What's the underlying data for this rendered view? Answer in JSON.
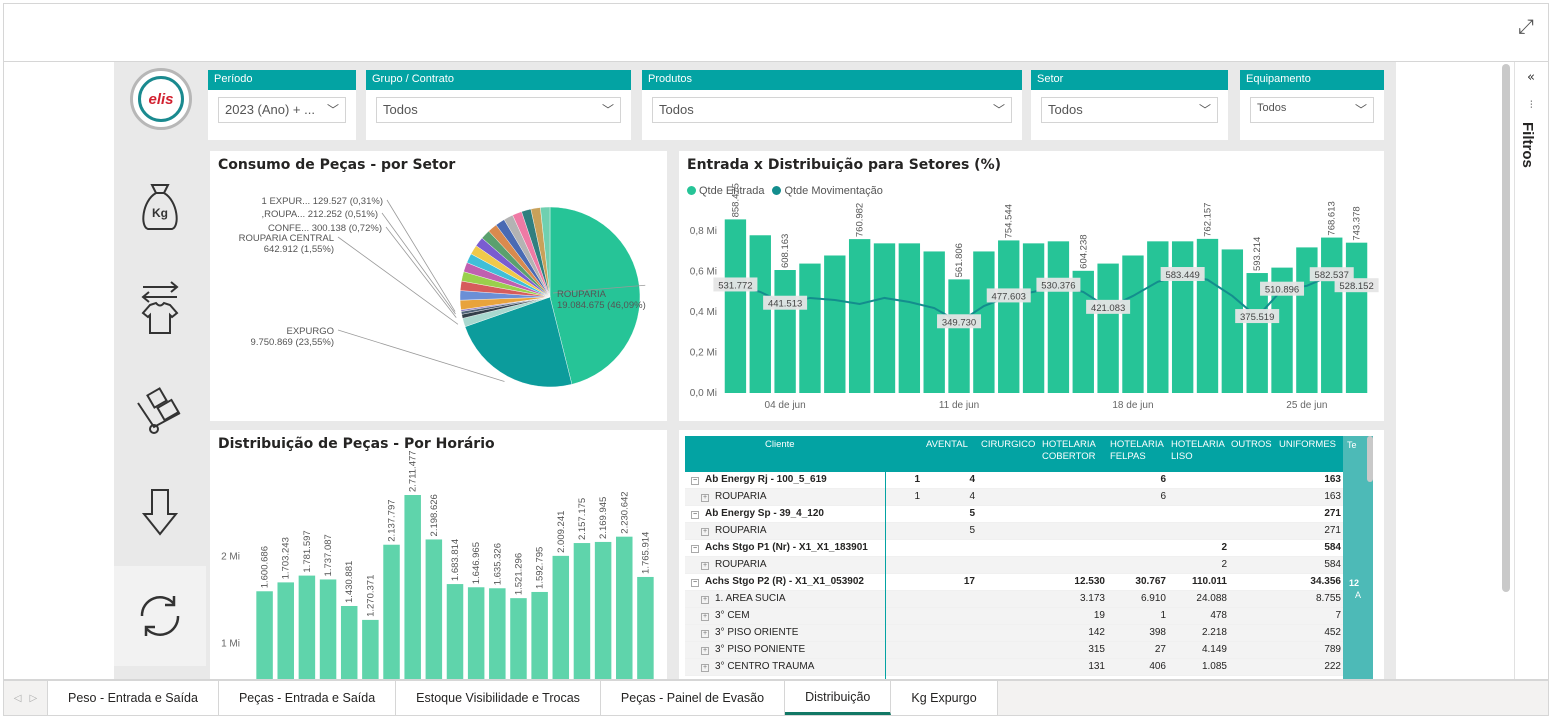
{
  "slicers": [
    {
      "label": "Período",
      "value": "2023 (Ano) + ..."
    },
    {
      "label": "Grupo / Contrato",
      "value": "Todos"
    },
    {
      "label": "Produtos",
      "value": "Todos"
    },
    {
      "label": "Setor",
      "value": "Todos"
    },
    {
      "label": "Equipamento",
      "value": "Todos"
    }
  ],
  "logo": {
    "text": "elis"
  },
  "nav_icons": [
    "kg-bag-icon",
    "shirt-exchange-icon",
    "hand-truck-boxes-icon",
    "arrow-down-icon",
    "refresh-icon"
  ],
  "filters_pane": {
    "label": "Filtros"
  },
  "tabs": [
    "Peso - Entrada e Saída",
    "Peças - Entrada e Saída",
    "Estoque Visibilidade e Trocas",
    "Peças - Painel de Evasão",
    "Distribuição",
    "Kg Expurgo"
  ],
  "active_tab": "Distribuição",
  "colors": {
    "accent": "#03a3a3",
    "bar": "#26c497",
    "line": "#138d8d",
    "pie_teal": "#0c9c9c"
  },
  "chart_data": [
    {
      "type": "pie",
      "title": "Consumo de Peças - por Setor",
      "slices": [
        {
          "label": "ROUPARIA",
          "display": "19.084.675 (46,09%)",
          "percent": 46.09
        },
        {
          "label": "EXPURGO",
          "display": "9.750.869 (23,55%)",
          "percent": 23.55
        },
        {
          "label": "ROUPARIA CENTRAL",
          "display": "642.912 (1,55%)",
          "percent": 1.55
        },
        {
          "label": "CONFE...",
          "display": "300.138 (0,72%)",
          "percent": 0.72
        },
        {
          "label": ",ROUPA...",
          "display": "212.252 (0,51%)",
          "percent": 0.51
        },
        {
          "label": "1 EXPUR...",
          "display": "129.527 (0,31%)",
          "percent": 0.31
        }
      ]
    },
    {
      "type": "bar",
      "title": "Entrada x Distribuição para Setores (%)",
      "legend": [
        "Qtde Entrada",
        "Qtde Movimentação"
      ],
      "y_ticks": [
        "0,0 Mi",
        "0,2 Mi",
        "0,4 Mi",
        "0,6 Mi",
        "0,8 Mi"
      ],
      "x_ticks": [
        "04 de jun",
        "11 de jun",
        "18 de jun",
        "25 de jun"
      ],
      "ylim": [
        0,
        0.9
      ],
      "bars": [
        0.858475,
        0.78,
        0.608163,
        0.64,
        0.68,
        0.760982,
        0.74,
        0.74,
        0.7,
        0.561806,
        0.7,
        0.754544,
        0.74,
        0.75,
        0.604238,
        0.64,
        0.68,
        0.75,
        0.75,
        0.762157,
        0.71,
        0.593214,
        0.62,
        0.72,
        0.768613,
        0.743378
      ],
      "bar_labels": [
        "858.475",
        "",
        "608.163",
        "",
        "",
        "760.982",
        "",
        "",
        "",
        "561.806",
        "",
        "754.544",
        "",
        "",
        "604.238",
        "",
        "",
        "",
        "",
        "762.157",
        "",
        "593.214",
        "",
        "",
        "768.613",
        "743.378"
      ],
      "line": [
        0.531772,
        0.5,
        0.441513,
        0.47,
        0.46,
        0.44,
        0.47,
        0.45,
        0.42,
        0.34973,
        0.43,
        0.477603,
        0.5,
        0.530376,
        0.5,
        0.421083,
        0.48,
        0.55,
        0.583449,
        0.56,
        0.48,
        0.375519,
        0.510896,
        0.53,
        0.582537,
        0.528152
      ],
      "line_labels": [
        "531.772",
        "",
        "441.513",
        "",
        "",
        "",
        "",
        "",
        "",
        "349.730",
        "",
        "477.603",
        "",
        "530.376",
        "",
        "421.083",
        "",
        "",
        "583.449",
        "",
        "",
        "375.519",
        "510.896",
        "",
        "582.537",
        "528.152"
      ]
    },
    {
      "type": "bar",
      "title": "Distribuição de Peças - Por Horário",
      "y_ticks": [
        "1 Mi",
        "2 Mi"
      ],
      "ylim": [
        0,
        3
      ],
      "values": [
        1.600686,
        1.703243,
        1.781597,
        1.737087,
        1.430881,
        1.270371,
        2.137797,
        2.711477,
        2.198626,
        1.683814,
        1.646965,
        1.635326,
        1.521296,
        1.592795,
        2.009241,
        2.157175,
        2.169945,
        2.230642,
        1.765914
      ],
      "labels": [
        "1.600.686",
        "1.703.243",
        "1.781.597",
        "1.737.087",
        "1.430.881",
        "1.270.371",
        "2.137.797",
        "2.711.477",
        "2.198.626",
        "1.683.814",
        "1.646.965",
        "1.635.326",
        "1.521.296",
        "1.592.795",
        "2.009.241",
        "2.157.175",
        "2.169.945",
        "2.230.642",
        "1.765.914"
      ]
    }
  ],
  "matrix": {
    "headers": [
      "Cliente",
      "AVENTAL",
      "CIRURGICO",
      "HOTELARIA COBERTOR",
      "HOTELARIA FELPAS",
      "HOTELARIA LISO",
      "OUTROS",
      "UNIFORMES",
      "Te"
    ],
    "rows": [
      {
        "level": 0,
        "label": "Ab Energy Rj - 100_5_619",
        "cells": [
          "1",
          "4",
          "",
          "",
          "6",
          "",
          "",
          "163"
        ]
      },
      {
        "level": 1,
        "label": "ROUPARIA",
        "cells": [
          "1",
          "4",
          "",
          "",
          "6",
          "",
          "",
          "163"
        ]
      },
      {
        "level": 0,
        "label": "Ab Energy Sp - 39_4_120",
        "cells": [
          "",
          "5",
          "",
          "",
          "",
          "",
          "",
          "271"
        ]
      },
      {
        "level": 1,
        "label": "ROUPARIA",
        "cells": [
          "",
          "5",
          "",
          "",
          "",
          "",
          "",
          "271"
        ]
      },
      {
        "level": 0,
        "label": "Achs Stgo P1 (Nr) - X1_X1_183901",
        "cells": [
          "",
          "",
          "",
          "",
          "",
          "2",
          "",
          "584"
        ]
      },
      {
        "level": 1,
        "label": "ROUPARIA",
        "cells": [
          "",
          "",
          "",
          "",
          "",
          "2",
          "",
          "584"
        ]
      },
      {
        "level": 0,
        "label": "Achs Stgo P2 (R) - X1_X1_053902",
        "cells": [
          "",
          "17",
          "",
          "12.530",
          "30.767",
          "110.011",
          "",
          "34.356"
        ]
      },
      {
        "level": 1,
        "label": "1. AREA SUCIA",
        "cells": [
          "",
          "",
          "",
          "3.173",
          "6.910",
          "24.088",
          "",
          "8.755"
        ]
      },
      {
        "level": 1,
        "label": "3° CEM",
        "cells": [
          "",
          "",
          "",
          "19",
          "1",
          "478",
          "",
          "7"
        ]
      },
      {
        "level": 1,
        "label": "3° PISO ORIENTE",
        "cells": [
          "",
          "",
          "",
          "142",
          "398",
          "2.218",
          "",
          "452"
        ]
      },
      {
        "level": 1,
        "label": "3° PISO PONIENTE",
        "cells": [
          "",
          "",
          "",
          "315",
          "27",
          "4.149",
          "",
          "789"
        ]
      },
      {
        "level": 1,
        "label": "3° CENTRO TRAUMA",
        "cells": [
          "",
          "",
          "",
          "131",
          "406",
          "1.085",
          "",
          "222"
        ]
      }
    ],
    "total_col_partial": [
      "12",
      "A"
    ]
  }
}
